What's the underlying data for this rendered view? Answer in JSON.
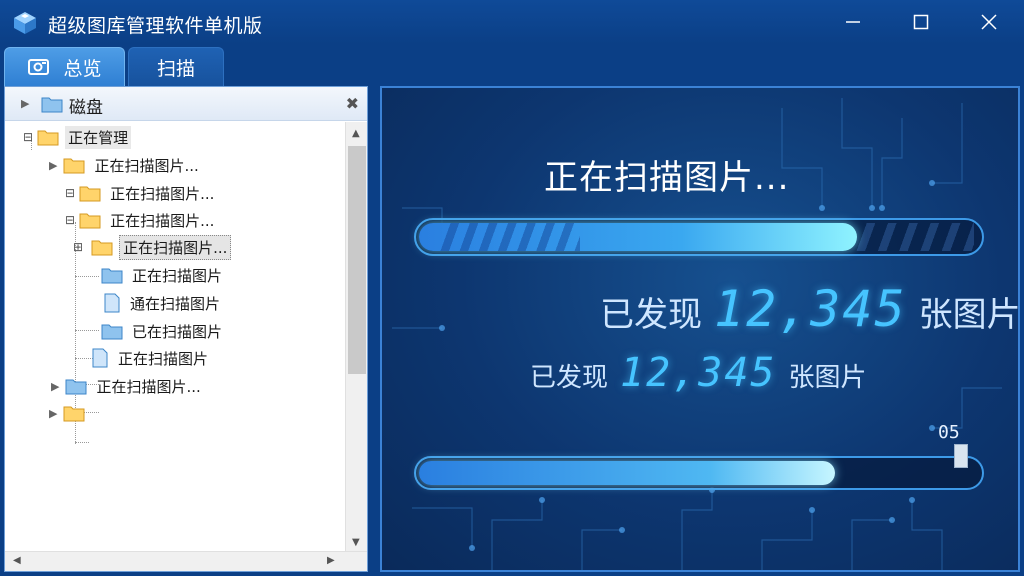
{
  "window": {
    "title": "超级图库管理软件单机版",
    "accent": "#0b3f86"
  },
  "tabs": [
    {
      "label": "总览",
      "icon": "photo-icon",
      "active": true
    },
    {
      "label": "扫描",
      "active": false
    }
  ],
  "tree": {
    "header_label": "磁盘",
    "rows": [
      {
        "label": "正在管理",
        "icon": "folder-yellow"
      },
      {
        "label": "正在扫描图片...",
        "icon": "folder-yellow"
      },
      {
        "label": "正在扫描图片...",
        "icon": "folder-yellow"
      },
      {
        "label": "正在扫描图片...",
        "icon": "folder-yellow"
      },
      {
        "label": "正在扫描图片...",
        "icon": "folder-yellow",
        "selected": true
      },
      {
        "label": "正在扫描图片",
        "icon": "folder-blue"
      },
      {
        "label": "通在扫描图片",
        "icon": "file-blue"
      },
      {
        "label": "已在扫描图片",
        "icon": "folder-blue"
      },
      {
        "label": "正在扫描图片",
        "icon": "file-blue"
      },
      {
        "label": "正在扫描图片...",
        "icon": "folder-blue"
      },
      {
        "label": "",
        "icon": "folder-yellow"
      }
    ]
  },
  "scan": {
    "title": "正在扫描图片...",
    "progress_main": 0.78,
    "found_prefix": "已发现",
    "found_count": "12,345",
    "found_suffix": "张图片",
    "found2_prefix": "已发现",
    "found2_count": "12,345",
    "found2_suffix": "张图片",
    "secondary_label": "05",
    "progress_secondary": 0.74
  }
}
